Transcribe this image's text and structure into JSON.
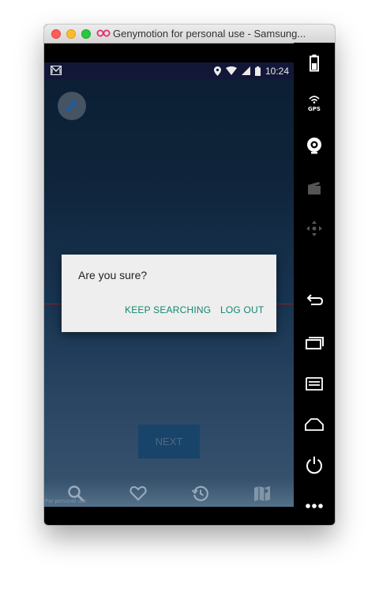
{
  "window": {
    "title": "Genymotion for personal use - Samsung..."
  },
  "status_bar": {
    "time": "10:24"
  },
  "dialog": {
    "message": "Are you sure?",
    "keep_searching_label": "KEEP SEARCHING",
    "log_out_label": "LOG OUT"
  },
  "main": {
    "next_label": "NEXT"
  },
  "bottom_nav": {
    "items": [
      {
        "icon": "search-icon"
      },
      {
        "icon": "heart-icon"
      },
      {
        "icon": "history-icon"
      },
      {
        "icon": "map-icon"
      }
    ],
    "watermark": "For personal use"
  },
  "sidebar": {
    "items": [
      {
        "icon": "battery-icon"
      },
      {
        "icon": "gps-icon",
        "label": "GPS"
      },
      {
        "icon": "webcam-icon"
      },
      {
        "icon": "clapperboard-icon"
      },
      {
        "icon": "dpad-icon"
      },
      {
        "icon": "back-icon"
      },
      {
        "icon": "recent-apps-icon"
      },
      {
        "icon": "menu-icon"
      },
      {
        "icon": "home-icon"
      },
      {
        "icon": "power-icon"
      },
      {
        "icon": "more-icon"
      }
    ]
  }
}
